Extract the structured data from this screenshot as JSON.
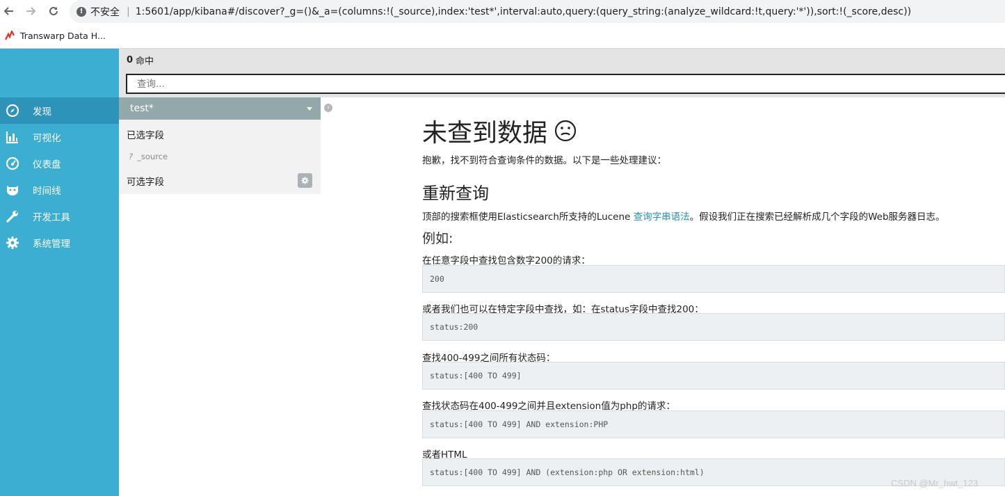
{
  "browser": {
    "insecure_label": "不安全",
    "url": "1‌‌‌‌‌‌‌‌‌‌‌‌‌‌‌‌‌‌‌‌‌‌‌‌‌‌‌‌‌‌‌‌‌‌‌:5601/app/kibana#/discover?_g=()&_a=(columns:!(_source),index:'test*',interval:auto,query:(query_string:(analyze_wildcard:!t,query:'*')),sort:!(_score,desc))",
    "bookmark": "Transwarp Data H..."
  },
  "sidebar": {
    "items": [
      {
        "label": "发现",
        "icon": "compass-icon"
      },
      {
        "label": "可视化",
        "icon": "bar-chart-icon"
      },
      {
        "label": "仪表盘",
        "icon": "gauge-icon"
      },
      {
        "label": "时间线",
        "icon": "timeline-icon"
      },
      {
        "label": "开发工具",
        "icon": "wrench-icon"
      },
      {
        "label": "系统管理",
        "icon": "gear-icon"
      }
    ]
  },
  "hits": {
    "count": "0",
    "label": "命中"
  },
  "search": {
    "placeholder": "查询..."
  },
  "field_list": {
    "index_pattern": "test*",
    "selected_heading": "已选字段",
    "source_field": "_source",
    "source_type": "?",
    "available_heading": "可选字段"
  },
  "main": {
    "title": "未查到数据",
    "subtitle": "抱歉，找不到符合查询条件的数据。以下是一些处理建议：",
    "refine_title": "重新查询",
    "refine_text_before": "顶部的搜索框使用Elasticsearch所支持的Lucene ",
    "refine_link": "查询字串语法",
    "refine_text_after": "。假设我们正在搜索已经解析成几个字段的Web服务器日志。",
    "examples_title": "例如:",
    "examples": [
      {
        "desc": "在任意字段中查找包含数字200的请求：",
        "code": "200"
      },
      {
        "desc": "或者我们也可以在特定字段中查找，如：在status字段中查找200：",
        "code": "status:200"
      },
      {
        "desc": "查找400-499之间所有状态码：",
        "code": "status:[400 TO 499]"
      },
      {
        "desc": "查找状态码在400-499之间并且extension值为php的请求：",
        "code": "status:[400 TO 499] AND extension:PHP"
      },
      {
        "desc": "或者HTML",
        "code": "status:[400 TO 499] AND (extension:php OR extension:html)"
      }
    ]
  },
  "watermark": "CSDN @Mr_hwt_123"
}
